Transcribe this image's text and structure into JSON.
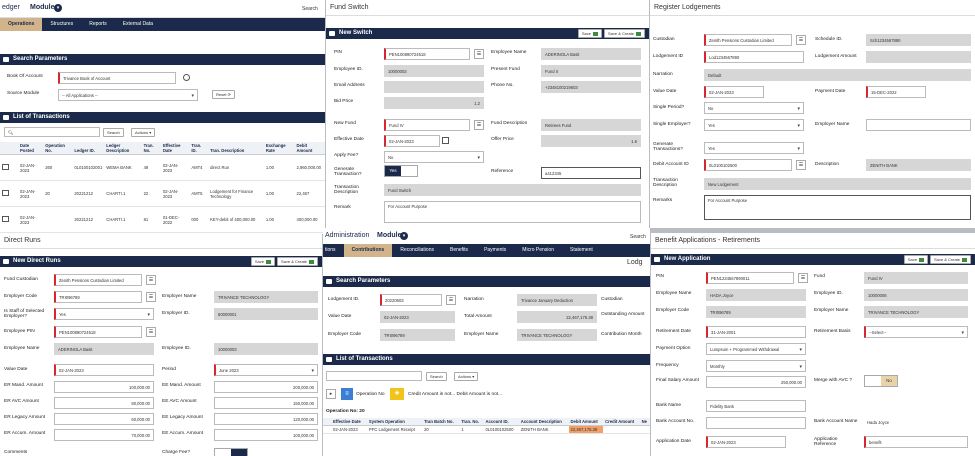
{
  "p1": {
    "app": "edger",
    "module": "Module",
    "search": "Search",
    "nav": [
      "Operations",
      "Structures",
      "Reports",
      "External Data"
    ],
    "search_params": "Search Parameters",
    "book_label": "Book Of Account",
    "book_value": "Trivance Book of Account",
    "source_label": "Source Module",
    "source_value": "-- All Applications --",
    "reset": "Reset",
    "list_title": "List of Transactions",
    "search_btn": "Search",
    "actions": "Actions",
    "cols": [
      "Date Posted",
      "Operation No.",
      "Ledger ID.",
      "Ledger Description",
      "Tran. No.",
      "Effective Date",
      "Tran. ID.",
      "Tran. Description",
      "Exchange Rate",
      "Debit Amount"
    ],
    "rows": [
      [
        "02-JAN-2023",
        "260",
        "0L0100102001",
        "WEMA BANK",
        "49",
        "02-JAN-2023",
        "AMT4",
        "direct Run",
        "1.00",
        "2,960,000.00"
      ],
      [
        "02-JAN-2023",
        "20",
        "20221212",
        "CHARTI.1",
        "22",
        "02-JAN-2023",
        "AMT5",
        "Lodgement for Finance Technology",
        "1.00",
        "22,467"
      ],
      [
        "02-JAN-2023",
        "",
        "20221212",
        "CHARTI.1",
        "81",
        "01-DEC-2022",
        "000",
        "KEY-debit of 400,000.00",
        "1.00",
        "400,000.00"
      ]
    ]
  },
  "p2": {
    "title": "Fund Switch",
    "bar": "New Switch",
    "save": "Save",
    "save_create": "Save & Create",
    "pin_label": "PIN",
    "pin": "PEN100890724518",
    "emp_name_label": "Employee Name",
    "emp_name": "ADERINOLA Basit",
    "emp_id_label": "Employee ID.",
    "emp_id": "10000003",
    "present_fund_label": "Present Fund",
    "present_fund": "Fund II",
    "email_label": "Email Address",
    "phone_label": "Phone No.",
    "phone": "+2348100219603",
    "bid_label": "Bid Price",
    "bid": "1.2",
    "new_fund_label": "New Fund",
    "new_fund": "Fund IV",
    "fund_desc_label": "Fund Description",
    "fund_desc": "Retirees Fund",
    "eff_label": "Effective Date",
    "eff": "02-JAN-2023",
    "offer_label": "Offer Price",
    "offer": "1.6",
    "apply_label": "Apply Fee?",
    "apply": "No",
    "gen_label": "Generate Transaction?",
    "gen": "Yes",
    "ref_label": "Reference",
    "ref": "a412345",
    "tdesc_label": "Transaction Description",
    "tdesc": "Fund Switch",
    "remark_label": "Remark",
    "remark": "For Account Purpose"
  },
  "p3": {
    "title": "Register Lodgements",
    "custodian_label": "Custodian",
    "custodian": "Zenith Pensions Custodian Limited",
    "schedule_label": "Schedule ID.",
    "schedule": "Sch1234567890",
    "lodge_id_label": "Lodgement ID",
    "lodge_id": "Lod1234567890",
    "lodge_amt_label": "Lodgement Amount",
    "narration_label": "Narration",
    "narration": "Default",
    "value_label": "Value Date",
    "value": "02-JAN-2023",
    "payment_label": "Payment Date",
    "payment": "15-DEC-2022",
    "single_label": "Single Period?",
    "single": "No",
    "employer_q_label": "Single Employer?",
    "employer_q": "Yes",
    "employer_name_label": "Employer Name",
    "gen_label": "Generate Transactions?",
    "gen": "Yes",
    "debit_label": "Debit Account ID",
    "debit": "0L0100102500",
    "desc_label": "Description",
    "desc": "ZENITH BANK",
    "tdesc_label": "Transaction Description",
    "tdesc": "New Lodgement",
    "remarks_label": "Remarks",
    "remarks": "For Account Purpose"
  },
  "p4": {
    "title": "Direct Runs",
    "bar": "New Direct Runs",
    "save": "Save",
    "save_create": "Save & Create",
    "fc_label": "Fund Custodian",
    "fc": "Zenith Pensions Custodian Limited",
    "ec_label": "Employer Code",
    "ec": "TRI096789",
    "en_label": "Employer Name",
    "en": "TRIVANCE TECHNOLOGY",
    "staff_label": "Is Staff of Selected Employer?",
    "staff": "Yes",
    "eid_label": "Employer ID.",
    "eid": "50000001",
    "epin_label": "Employee PIN",
    "epin": "PEN100890724518",
    "ename_label": "Employee Name",
    "ename": "ADERINOLA Basit",
    "eeid_label": "Employee ID.",
    "eeid": "10000003",
    "vd_label": "Value Date",
    "vd": "02-JAN-2023",
    "period_label": "Period",
    "period": "June 2023",
    "amounts": [
      [
        "ER Mand. Amount",
        "100,000.00",
        "EE Mand. Amount",
        "200,000.00"
      ],
      [
        "ER AVC Amount",
        "80,000.00",
        "EE AVC Amount",
        "150,000.00"
      ],
      [
        "ER Legacy Amount",
        "60,000.00",
        "EE Legacy Amount",
        "120,000.00"
      ],
      [
        "ER Accum. Amount",
        "70,000.00",
        "EE Accum. Amount",
        "100,000.00"
      ]
    ],
    "comments": "Comments",
    "charge": "Charge Fee?"
  },
  "p5": {
    "app": "Administration",
    "module": "Module",
    "search": "Search",
    "nav": [
      "tions",
      "Contributions",
      "Reconciliations",
      "Benefits",
      "Payments",
      "Micro Pension",
      "Statement"
    ],
    "tail": "Lodg",
    "search_params": "Search Parameters",
    "lid_label": "Lodgement ID.",
    "lid": "20220603",
    "narr_label": "Narration",
    "narr": "Trivance January Deduction",
    "cust_label": "Custodian",
    "vd_label": "Value Date",
    "vd": "02-JAN-2023",
    "ta_label": "Total Amount",
    "ta": "22,467,175.38",
    "out_label": "Outstanding Amount",
    "ec_label": "Employer Code",
    "ec": "TRI096789",
    "en_label": "Employer Name",
    "en": "TRIVANCE TECHNOLOGY",
    "cm_label": "Contribution Month",
    "list_title": "List of Transactions",
    "search_btn": "Search",
    "actions": "Actions",
    "op_no": "Operation No",
    "credit": "Credit Amount is not... Debit Amount is not...",
    "op_title": "Operation No: 20",
    "cols": [
      "Effective Date",
      "System Operation",
      "Tran Batch No.",
      "Tran. No.",
      "Account ID.",
      "Account Description",
      "Debit Amount",
      "Credit Amount",
      "Ne"
    ],
    "row": [
      "02-JAN-2023",
      "PFC Lodgement Receipt",
      "20",
      "1",
      "0L0100102500",
      "ZENITH BANK",
      "22,467,175.38",
      "",
      ""
    ]
  },
  "p6": {
    "title": "Benefit Applications - Retirements",
    "bar": "New Application",
    "save": "Save",
    "save_create": "Save & Create",
    "pin_label": "PIN",
    "pin": "PEN1234567890011",
    "fund_label": "Fund",
    "fund": "Fund IV",
    "ename_label": "Employee Name",
    "ename": "HADA Joyce",
    "eid_label": "Employee ID.",
    "eid": "10000006",
    "ec_label": "Employer Code",
    "ec": "TRI096789",
    "en_label": "Employer Name",
    "en": "TRIVANCE TECHNOLOGY",
    "rd_label": "Retirement Date",
    "rd": "31-JAN-2001",
    "rb_label": "Retirement Basis",
    "rb": "--Select--",
    "po_label": "Payment Option",
    "po": "Lumpsum + Programmed Withdrawal",
    "fq_label": "Frequency",
    "fq": "Monthly",
    "fs_label": "Final Salary Amount",
    "fs": "250,000.00",
    "avc_label": "Merge with AVC ?",
    "avc": "No",
    "bn_label": "Bank Name",
    "bn": "Fidelity Bank",
    "ban_label": "Bank Account No.",
    "ba_name_label": "Bank Account Name",
    "ba_name": "Hada Joyce",
    "ad_label": "Application Date",
    "ad": "02-JAN-2023",
    "ar_label": "Application Reference",
    "ar": "benefit"
  }
}
